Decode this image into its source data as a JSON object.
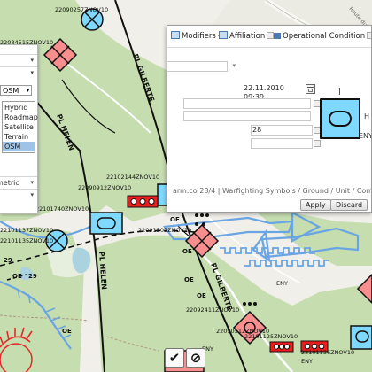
{
  "map": {
    "road_label": "Route du M",
    "street_labels": [
      "PL HELEN",
      "PL GILBERTE",
      "PL HELEN",
      "PL GILBERTE"
    ],
    "unit_labels": [
      "22090257ZNOV10",
      "22084515ZNOV10",
      "22102144ZNOV10",
      "22090912ZNOV10",
      "22101740ZNOV10",
      "22101137ZNOV10",
      "22101135ZNOV10",
      "22091502ZNOV10",
      "22092411ZNOV10",
      "22090512ZNOV10",
      "22101125ZNOV10",
      "22101136ZNOV10"
    ],
    "boundary_labels": [
      "29",
      "OE",
      "29",
      "OE",
      "OE",
      "OE",
      "OE",
      "OE"
    ],
    "echelon_labels": [
      "ENY",
      "ENY",
      "ENY"
    ]
  },
  "layer_panel": {
    "selected_layer": "OSM",
    "layers": [
      "Hybrid",
      "Roadmap",
      "Satellite",
      "Terrain",
      "OSM"
    ],
    "projection_label": "metric"
  },
  "editor": {
    "tabs": {
      "modifiers": "Modifiers",
      "affiliation": "Affiliation",
      "operational_condition": "Operational Condition"
    },
    "datetime_value": "22.11.2010 09:39",
    "quantity_value": "28",
    "side_letters": [
      "H",
      "ENY"
    ],
    "status_line": "arm.co 28/4 | Warfighting Symbols / Ground / Unit / Combat / Armor",
    "apply_label": "Apply",
    "discard_label": "Discard"
  },
  "toolbar": {
    "confirm_glyph": "✔",
    "cancel_glyph": "⊘"
  }
}
